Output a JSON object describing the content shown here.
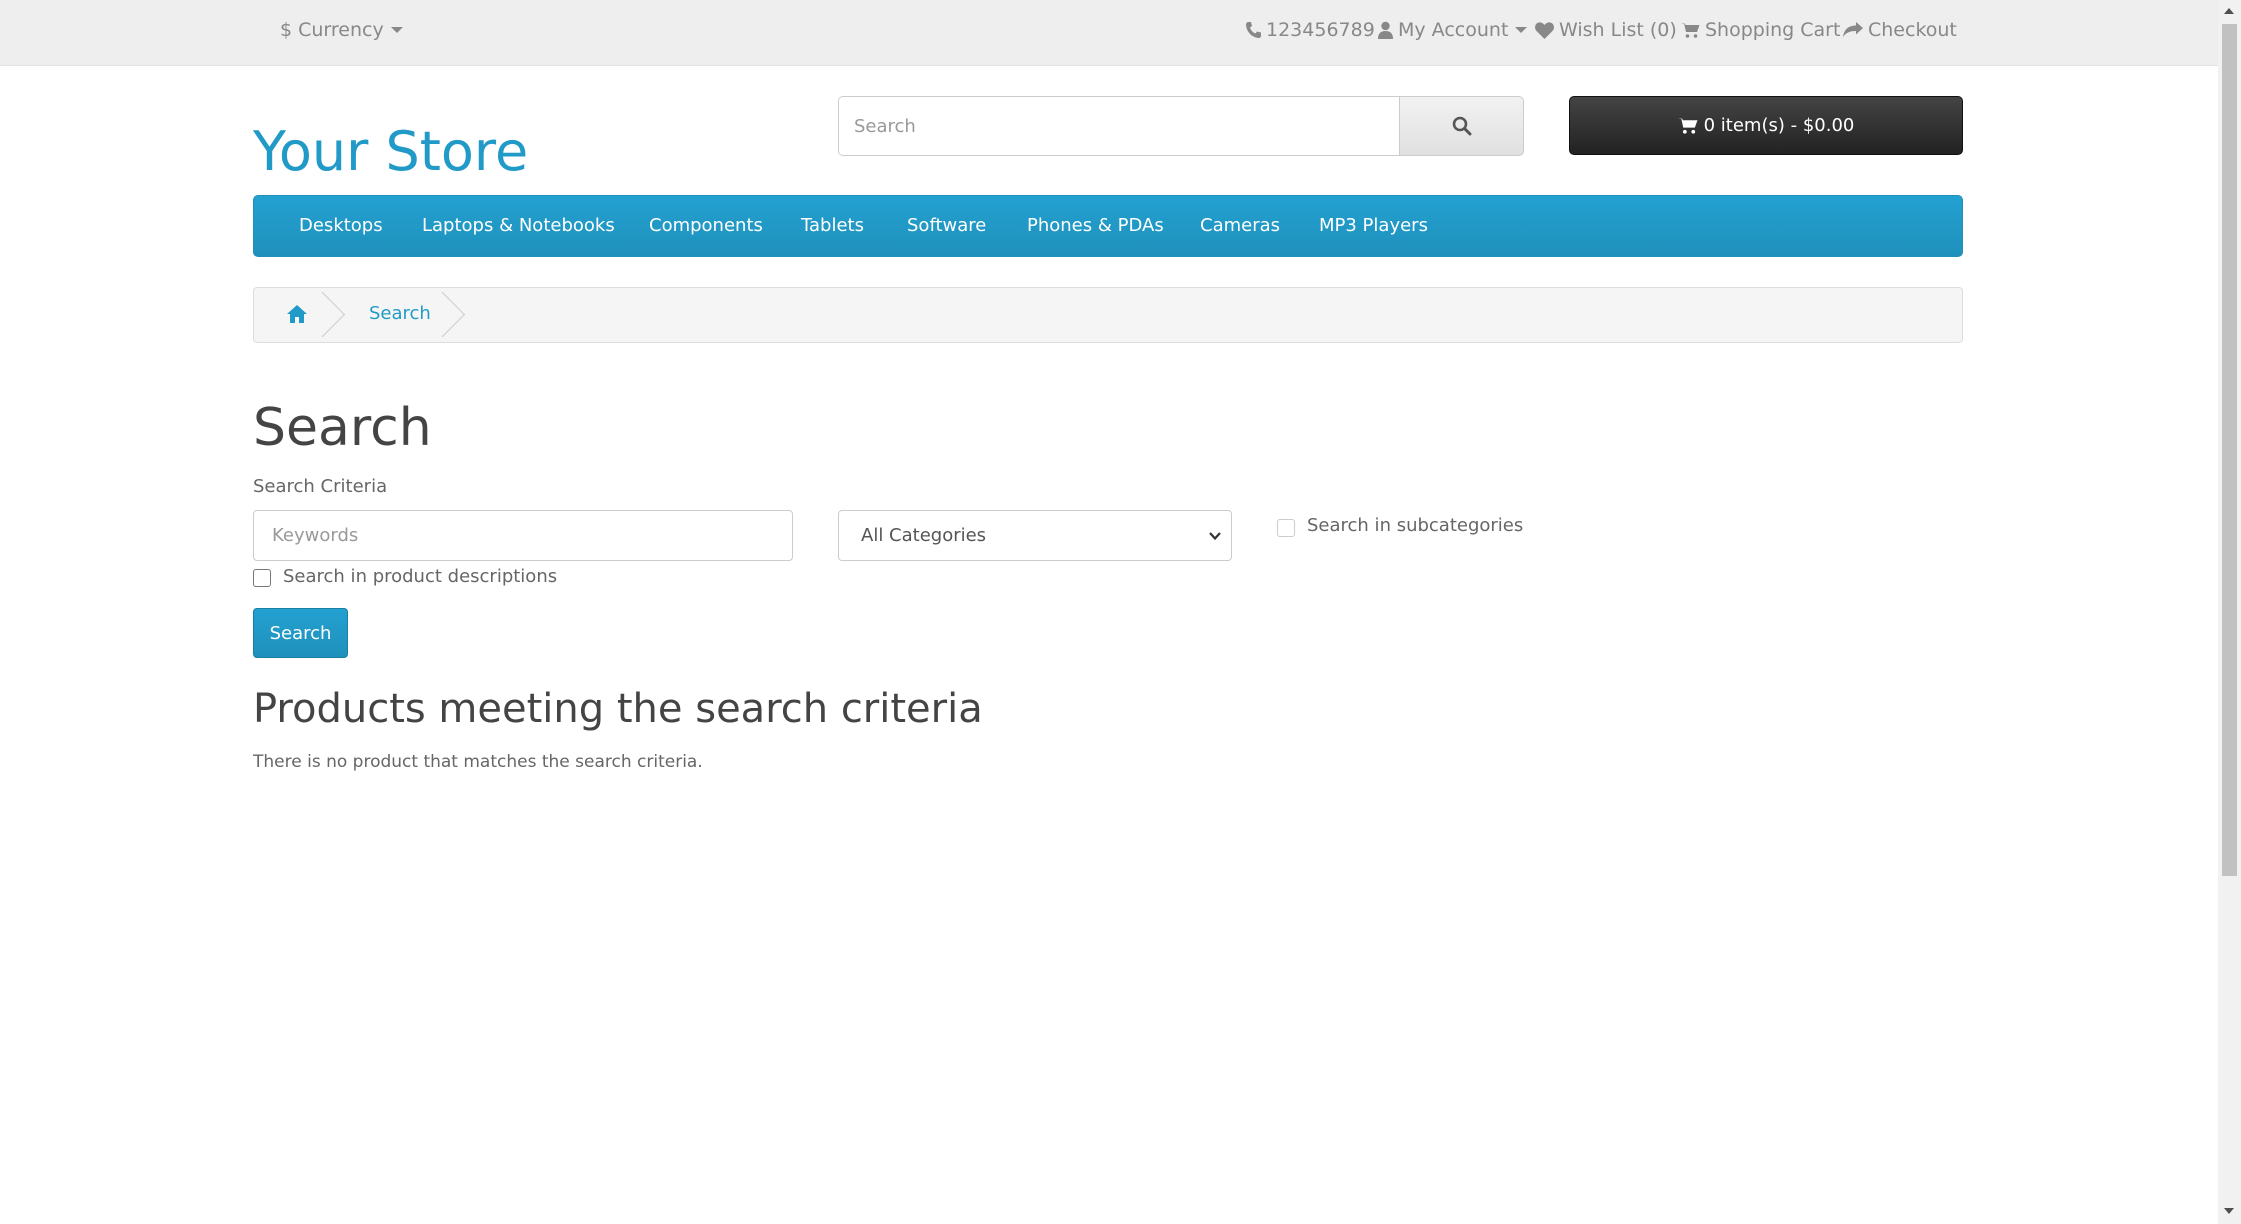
{
  "topbar": {
    "currency_label": "$ Currency",
    "phone": "123456789",
    "my_account": "My Account",
    "wish_list": "Wish List (0)",
    "shopping_cart": "Shopping Cart",
    "checkout": "Checkout"
  },
  "header": {
    "logo": "Your Store",
    "search_placeholder": "Search",
    "cart_button": "0 item(s) - $0.00"
  },
  "menu": {
    "items": [
      "Desktops",
      "Laptops & Notebooks",
      "Components",
      "Tablets",
      "Software",
      "Phones & PDAs",
      "Cameras",
      "MP3 Players"
    ]
  },
  "breadcrumb": {
    "current": "Search"
  },
  "content": {
    "title": "Search",
    "criteria_label": "Search Criteria",
    "keywords_placeholder": "Keywords",
    "category_selected": "All Categories",
    "subcategories_label": "Search in subcategories",
    "descriptions_label": "Search in product descriptions",
    "search_button": "Search",
    "results_title": "Products meeting the search criteria",
    "results_text": "There is no product that matches the search criteria."
  },
  "colors": {
    "accent": "#229ac8",
    "cart_bg": "#363636",
    "topbar_bg": "#eeeeee"
  },
  "icons": [
    "phone-icon",
    "user-icon",
    "heart-icon",
    "cart-icon",
    "share-icon",
    "search-icon",
    "home-icon",
    "chevron-down-icon"
  ]
}
